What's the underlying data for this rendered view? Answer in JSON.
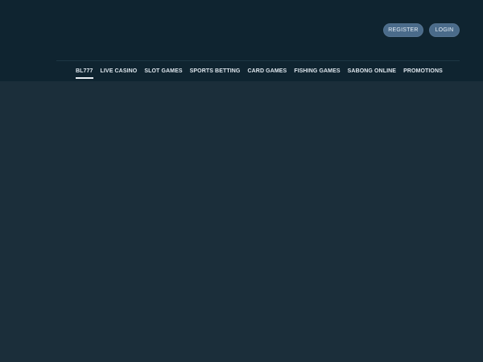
{
  "header": {
    "auth": {
      "register_label": "REGISTER",
      "login_label": "LOGIN"
    },
    "nav": {
      "active_index": 0,
      "items": [
        {
          "label": "BL777"
        },
        {
          "label": "LIVE CASINO"
        },
        {
          "label": "SLOT GAMES"
        },
        {
          "label": "SPORTS BETTING"
        },
        {
          "label": "CARD GAMES"
        },
        {
          "label": "FISHING GAMES"
        },
        {
          "label": "SABONG ONLINE"
        },
        {
          "label": "PROMOTIONS"
        }
      ]
    }
  },
  "colors": {
    "header_background": "#0f2430",
    "page_background": "#1b2e3a",
    "button_background": "#4a6b8a",
    "nav_text": "#dfe7ee"
  }
}
